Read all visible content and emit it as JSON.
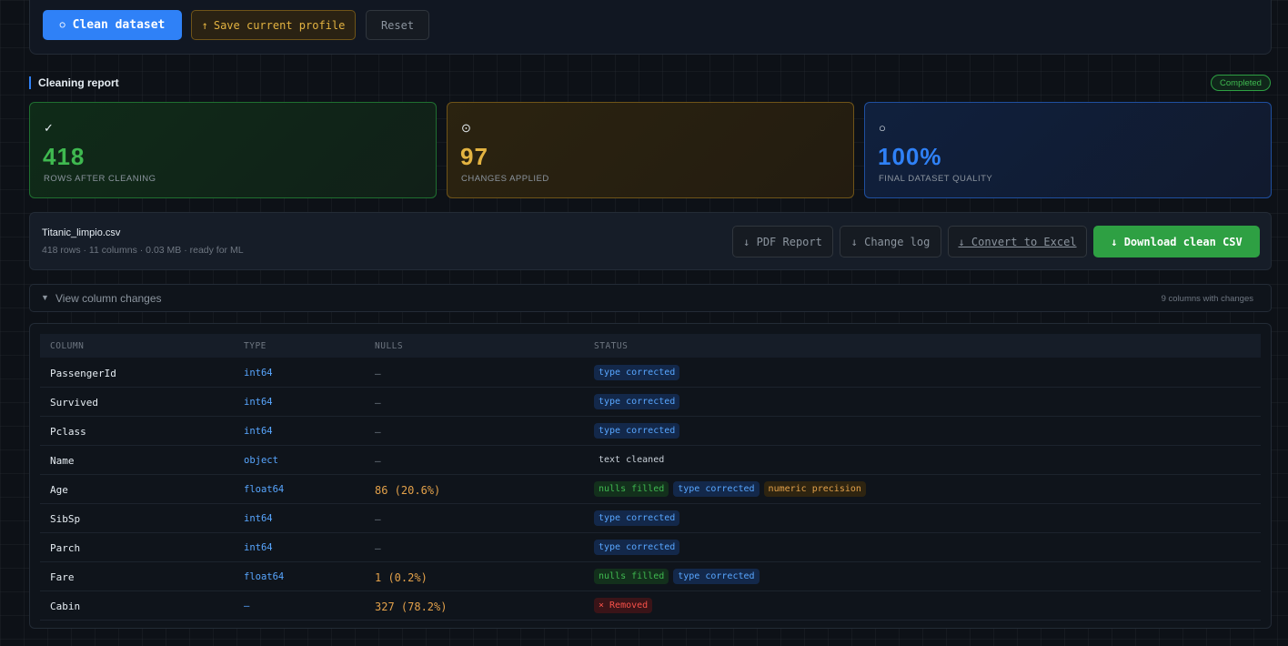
{
  "toolbar": {
    "clean_label": "Clean dataset",
    "save_label": "Save current profile",
    "reset_label": "Reset"
  },
  "report": {
    "title": "Cleaning report",
    "status": "Completed"
  },
  "stats": [
    {
      "icon": "check-icon",
      "value": "418",
      "label": "ROWS AFTER CLEANING"
    },
    {
      "icon": "target-icon",
      "value": "97",
      "label": "CHANGES APPLIED"
    },
    {
      "icon": "circle-icon",
      "value": "100%",
      "label": "FINAL DATASET QUALITY"
    }
  ],
  "file": {
    "name": "Titanic_limpio.csv",
    "meta": "418 rows · 11 columns · 0.03 MB · ready for ML",
    "pdf_label": "↓ PDF Report",
    "log_label": "↓ Change log",
    "excel_label": "↓ Convert to Excel",
    "csv_label": "↓ Download clean CSV"
  },
  "changes": {
    "toggle_label": "View column changes",
    "count_label": "9 columns with changes"
  },
  "table": {
    "headers": [
      "COLUMN",
      "TYPE",
      "NULLS",
      "STATUS"
    ],
    "rows": [
      {
        "column": "PassengerId",
        "type": "int64",
        "nulls": "—",
        "status": [
          {
            "text": "type corrected",
            "kind": "blue"
          }
        ]
      },
      {
        "column": "Survived",
        "type": "int64",
        "nulls": "—",
        "status": [
          {
            "text": "type corrected",
            "kind": "blue"
          }
        ]
      },
      {
        "column": "Pclass",
        "type": "int64",
        "nulls": "—",
        "status": [
          {
            "text": "type corrected",
            "kind": "blue"
          }
        ]
      },
      {
        "column": "Name",
        "type": "object",
        "nulls": "—",
        "status": [
          {
            "text": "text cleaned",
            "kind": "plain"
          }
        ]
      },
      {
        "column": "Age",
        "type": "float64",
        "nulls": "86 (20.6%)",
        "status": [
          {
            "text": "nulls filled",
            "kind": "green"
          },
          {
            "text": "type corrected",
            "kind": "blue"
          },
          {
            "text": "numeric precision",
            "kind": "amber"
          }
        ]
      },
      {
        "column": "SibSp",
        "type": "int64",
        "nulls": "—",
        "status": [
          {
            "text": "type corrected",
            "kind": "blue"
          }
        ]
      },
      {
        "column": "Parch",
        "type": "int64",
        "nulls": "—",
        "status": [
          {
            "text": "type corrected",
            "kind": "blue"
          }
        ]
      },
      {
        "column": "Fare",
        "type": "float64",
        "nulls": "1 (0.2%)",
        "status": [
          {
            "text": "nulls filled",
            "kind": "green"
          },
          {
            "text": "type corrected",
            "kind": "blue"
          }
        ]
      },
      {
        "column": "Cabin",
        "type": "—",
        "nulls": "327 (78.2%)",
        "status": [
          {
            "text": "× Removed",
            "kind": "red"
          }
        ]
      }
    ]
  },
  "colors": {
    "accent_blue": "#2f81f7",
    "success_green": "#2ea043",
    "warning_amber": "#e3b341",
    "danger_red": "#f85149"
  }
}
